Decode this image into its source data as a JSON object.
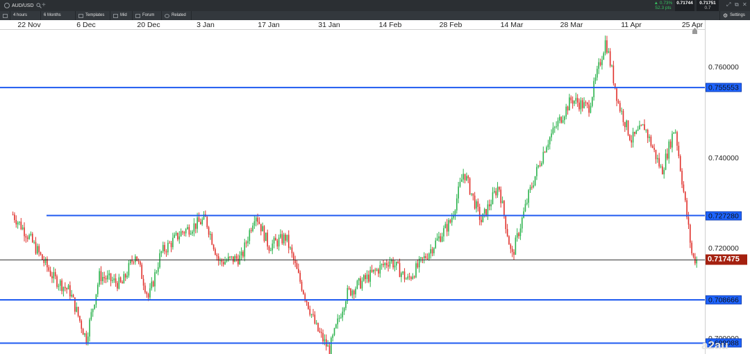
{
  "topbar": {
    "symbol": "AUD/USD",
    "change_pct": "▲ 0.73%",
    "change_pts": "52.3 pts",
    "bid": "0.71744",
    "ask": "0.71751",
    "spread": "0.7",
    "settings_label": "Settings"
  },
  "toolbar": {
    "interval": "4 hours",
    "range": "6 Months",
    "templates": "Templates",
    "price_type": "Mid",
    "forum": "Forum",
    "related": "Related"
  },
  "icons": [
    "clock-icon",
    "search-icon",
    "plus-icon",
    "grid-icon",
    "candles-icon",
    "chat-icon",
    "eye-icon",
    "expand-icon",
    "popout-icon",
    "close-icon",
    "gear-icon",
    "scroll-to-end-icon"
  ],
  "colors": {
    "up_candle": "#2bb24c",
    "down_candle": "#e0302b",
    "level_line": "#1e5af0",
    "current_line": "#333333",
    "current_tag": "#a4200f"
  },
  "date_axis": [
    "22 Nov",
    "6 Dec",
    "20 Dec",
    "3 Jan",
    "17 Jan",
    "31 Jan",
    "14 Feb",
    "28 Feb",
    "14 Mar",
    "28 Mar",
    "11 Apr",
    "25 Apr"
  ],
  "price_axis": [
    "0.760000",
    "0.740000",
    "0.720000",
    "0.700000"
  ],
  "current_price": "0.717475",
  "chart_data": {
    "type": "candlestick",
    "instrument": "AUD/USD",
    "interval": "4 hours",
    "y_ticks": [
      0.76,
      0.74,
      0.72,
      0.7
    ],
    "ylim": [
      0.6967,
      0.7683
    ],
    "current_price": 0.717475,
    "horizontal_levels": [
      {
        "label": "0.755553",
        "value": 0.755553
      },
      {
        "label": "0.727280",
        "value": 0.72728
      },
      {
        "label": "0.708666",
        "value": 0.708666
      },
      {
        "label": "0.699088",
        "value": 0.699088
      }
    ],
    "price_path": [
      {
        "date": "18 Nov",
        "close": 0.7275
      },
      {
        "date": "22 Nov",
        "close": 0.7225
      },
      {
        "date": "28 Nov",
        "close": 0.7135
      },
      {
        "date": "2 Dec",
        "close": 0.7105
      },
      {
        "date": "6 Dec",
        "close": 0.7
      },
      {
        "date": "9 Dec",
        "close": 0.714
      },
      {
        "date": "14 Dec",
        "close": 0.712
      },
      {
        "date": "17 Dec",
        "close": 0.719
      },
      {
        "date": "20 Dec",
        "close": 0.709
      },
      {
        "date": "23 Dec",
        "close": 0.719
      },
      {
        "date": "28 Dec",
        "close": 0.7235
      },
      {
        "date": "3 Jan",
        "close": 0.7265
      },
      {
        "date": "6 Jan",
        "close": 0.717
      },
      {
        "date": "11 Jan",
        "close": 0.718
      },
      {
        "date": "14 Jan",
        "close": 0.728
      },
      {
        "date": "17 Jan",
        "close": 0.7205
      },
      {
        "date": "21 Jan",
        "close": 0.7225
      },
      {
        "date": "24 Jan",
        "close": 0.7135
      },
      {
        "date": "28 Jan",
        "close": 0.7025
      },
      {
        "date": "31 Jan",
        "close": 0.6975
      },
      {
        "date": "4 Feb",
        "close": 0.71
      },
      {
        "date": "8 Feb",
        "close": 0.713
      },
      {
        "date": "14 Feb",
        "close": 0.7175
      },
      {
        "date": "18 Feb",
        "close": 0.713
      },
      {
        "date": "22 Feb",
        "close": 0.718
      },
      {
        "date": "28 Feb",
        "close": 0.726
      },
      {
        "date": "3 Mar",
        "close": 0.737
      },
      {
        "date": "7 Mar",
        "close": 0.726
      },
      {
        "date": "11 Mar",
        "close": 0.734
      },
      {
        "date": "14 Mar",
        "close": 0.718
      },
      {
        "date": "18 Mar",
        "close": 0.732
      },
      {
        "date": "22 Mar",
        "close": 0.743
      },
      {
        "date": "28 Mar",
        "close": 0.753
      },
      {
        "date": "1 Apr",
        "close": 0.751
      },
      {
        "date": "5 Apr",
        "close": 0.766
      },
      {
        "date": "8 Apr",
        "close": 0.752
      },
      {
        "date": "11 Apr",
        "close": 0.744
      },
      {
        "date": "14 Apr",
        "close": 0.747
      },
      {
        "date": "18 Apr",
        "close": 0.737
      },
      {
        "date": "21 Apr",
        "close": 0.747
      },
      {
        "date": "25 Apr",
        "close": 0.718
      },
      {
        "date": "26 Apr",
        "close": 0.7175
      }
    ]
  }
}
